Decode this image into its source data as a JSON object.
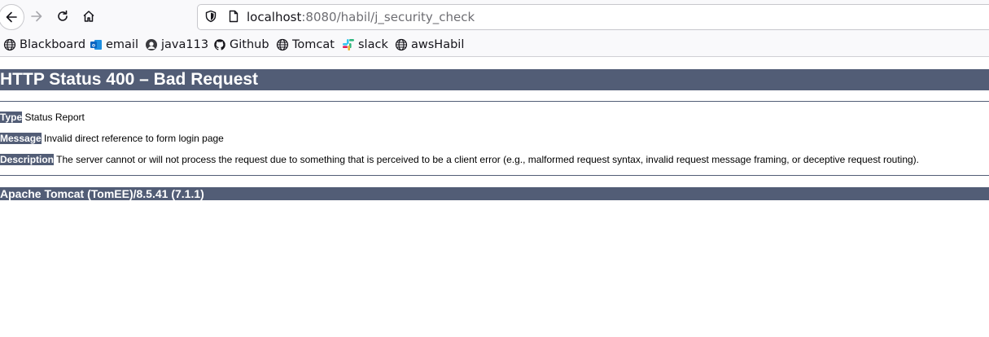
{
  "browser": {
    "url_host": "localhost",
    "url_rest": ":8080/habil/j_security_check",
    "bookmarks": [
      {
        "label": "Blackboard",
        "icon": "globe-icon"
      },
      {
        "label": "email",
        "icon": "outlook-icon"
      },
      {
        "label": "java113",
        "icon": "globe-icon"
      },
      {
        "label": "Github",
        "icon": "github-icon"
      },
      {
        "label": "Tomcat",
        "icon": "globe-icon"
      },
      {
        "label": "slack",
        "icon": "slack-icon"
      },
      {
        "label": "awsHabil",
        "icon": "globe-icon"
      }
    ]
  },
  "page": {
    "title": "HTTP Status 400 – Bad Request",
    "type_label": "Type",
    "type_value": "Status Report",
    "message_label": "Message",
    "message_value": "Invalid direct reference to form login page",
    "description_label": "Description",
    "description_value": "The server cannot or will not process the request due to something that is perceived to be a client error (e.g., malformed request syntax, invalid request message framing, or deceptive request routing).",
    "footer": "Apache Tomcat (TomEE)/8.5.41 (7.1.1)"
  },
  "colors": {
    "tomcat_header": "#525d76",
    "chrome_bg": "#f9f9fb"
  }
}
